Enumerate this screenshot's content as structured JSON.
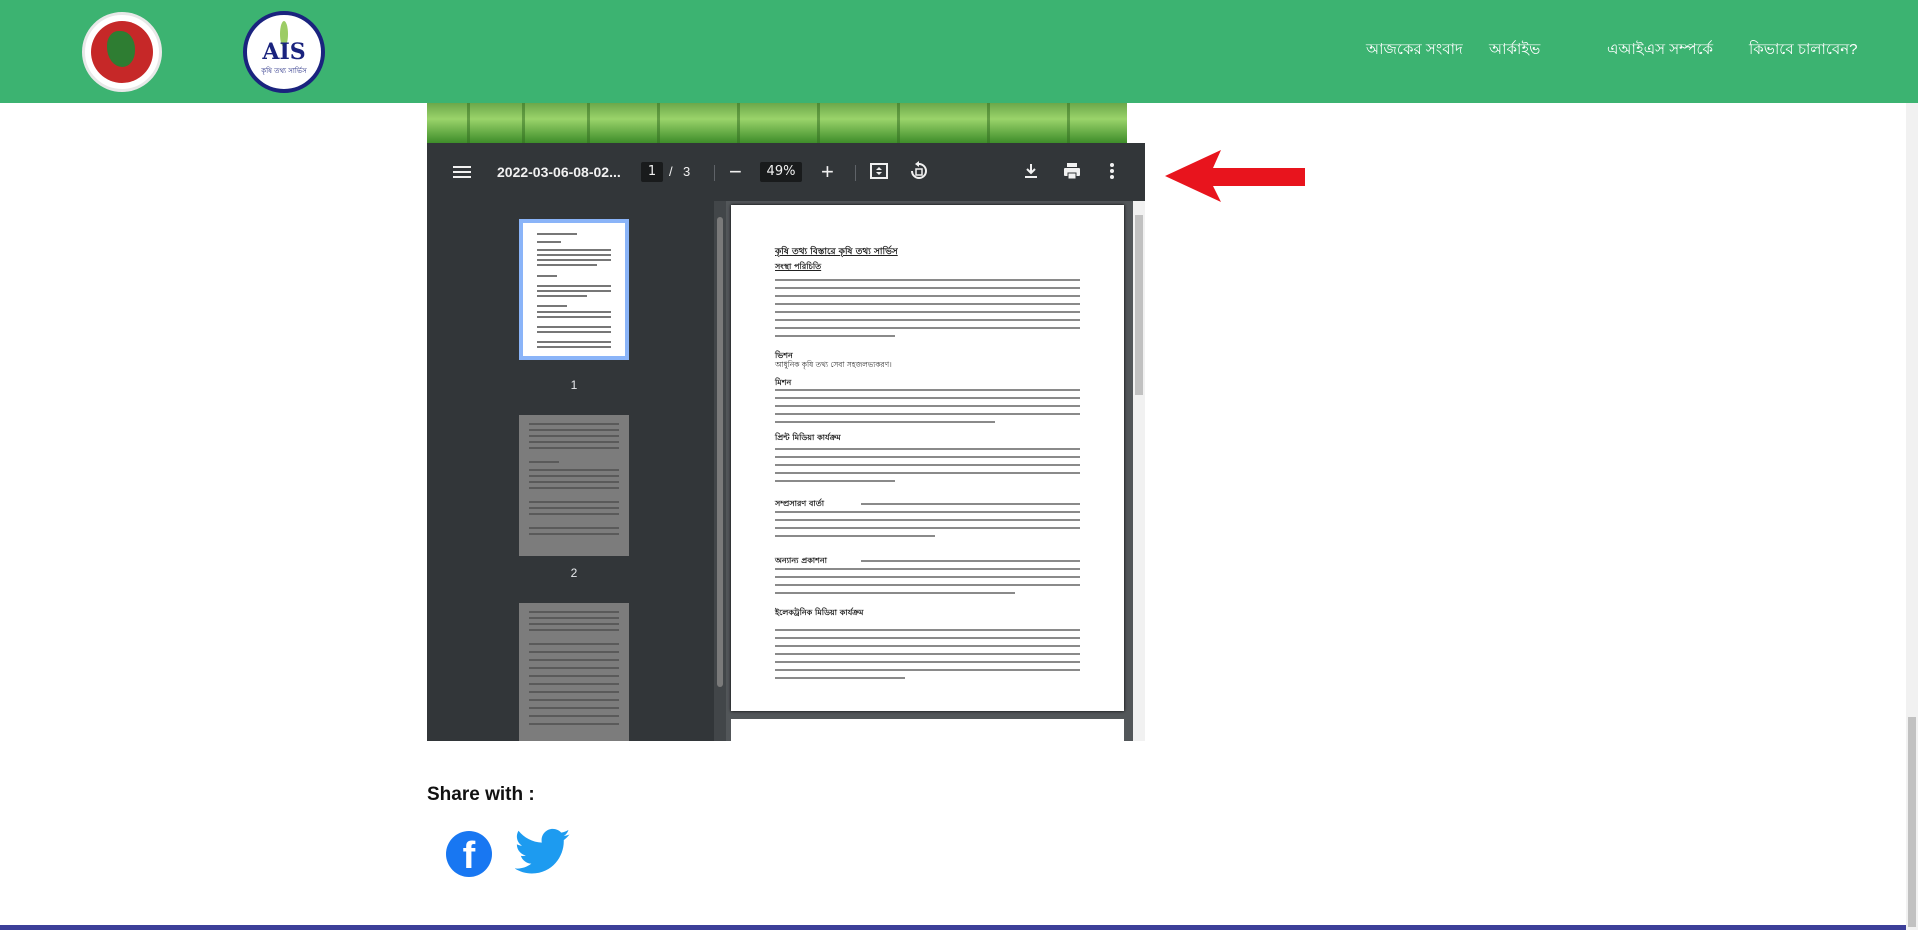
{
  "header": {
    "nav": [
      {
        "label": "আজকের সংবাদ"
      },
      {
        "label": "আর্কাইভ"
      },
      {
        "label": "এআইএস সম্পর্কে"
      },
      {
        "label": "কিভাবে চালাবেন?"
      }
    ],
    "logo_ais_text": "AIS",
    "logo_ais_sub": "কৃষি তথ্য সার্ভিস"
  },
  "pdf_viewer": {
    "filename": "2022-03-06-08-02...",
    "current_page": "1",
    "page_separator": "/",
    "total_pages": "3",
    "zoom": "49%",
    "thumbnails": [
      {
        "label": "1"
      },
      {
        "label": "2"
      }
    ],
    "document": {
      "title": "কৃষি তথ্য বিস্তারে কৃষি তথ্য সার্ভিস",
      "sections": [
        {
          "heading": "সংস্থা পরিচিতি"
        },
        {
          "heading": "ভিশন",
          "text": "আধুনিক কৃষি তথ্য সেবা সহজলভ্যকরণ।"
        },
        {
          "heading": "মিশন"
        },
        {
          "heading": "প্রিন্ট মিডিয়া কার্যক্রম"
        },
        {
          "heading": "সম্প্রসারণ বার্তা"
        },
        {
          "heading": "অন্যান্য প্রকাশনা"
        },
        {
          "heading": "ইলেকট্রনিক মিডিয়া কার্যক্রম"
        }
      ]
    }
  },
  "share": {
    "title": "Share with :",
    "facebook_letter": "f"
  },
  "colors": {
    "header_bg": "#3cb371",
    "viewer_toolbar": "#323639",
    "arrow": "#e8141d",
    "facebook": "#1877f2",
    "twitter": "#1d9bf0"
  }
}
